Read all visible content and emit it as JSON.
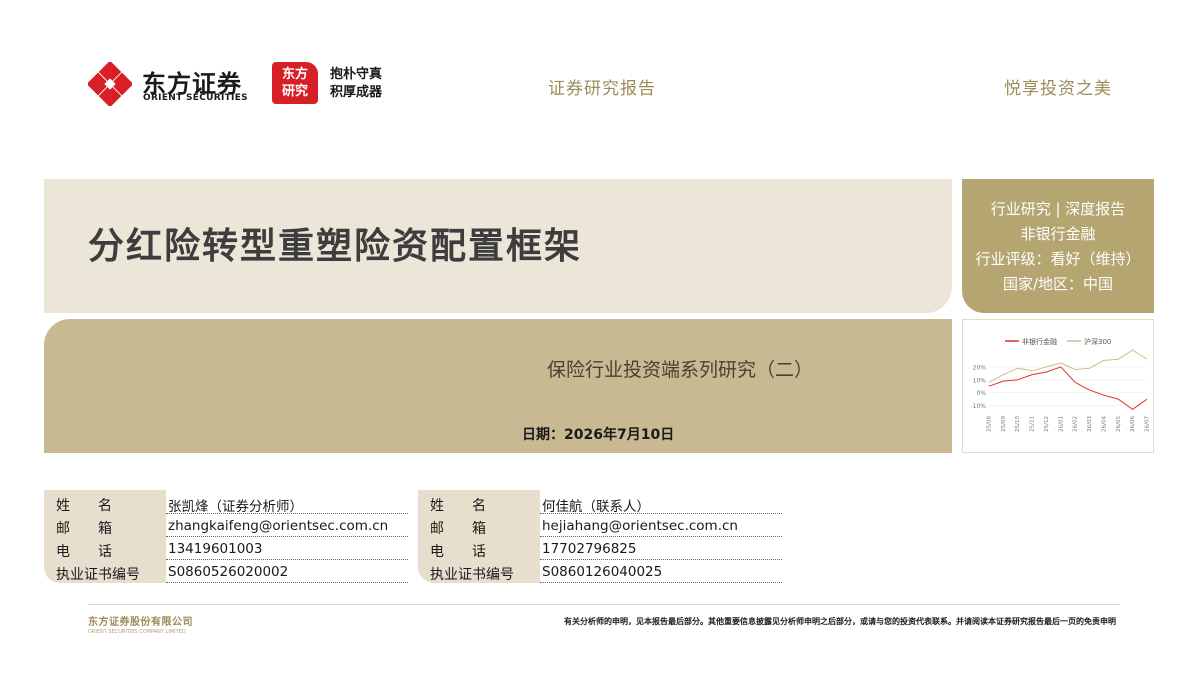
{
  "header": {
    "logo_cn": "东方证券",
    "logo_en": "ORIENT SECURITIES",
    "badge_line1": "东方",
    "badge_line2": "研究",
    "motto_line1": "抱朴守真",
    "motto_line2": "积厚成器",
    "center_title": "证券研究报告",
    "right_slogan": "悦享投资之美"
  },
  "report": {
    "title": "分红险转型重塑险资配置框架",
    "subtitle": "保险行业投资端系列研究（二）",
    "date": "日期：2026年7月10日"
  },
  "info": {
    "line1": "行业研究 | 深度报告",
    "line2": "非银行金融",
    "line3": "行业评级：看好（维持）",
    "line4": "国家/地区：中国"
  },
  "chart_data": {
    "type": "line",
    "x": [
      "25/08",
      "25/09",
      "25/10",
      "25/11",
      "25/12",
      "26/01",
      "26/02",
      "26/03",
      "26/04",
      "26/05",
      "26/06",
      "26/07"
    ],
    "series": [
      {
        "name": "非银行金融",
        "values": [
          5,
          9,
          10,
          14,
          16,
          20,
          8,
          2,
          -2,
          -5,
          -13,
          -5
        ],
        "color": "#e0302a"
      },
      {
        "name": "沪深300",
        "values": [
          8,
          14,
          19,
          17,
          20,
          23,
          18,
          19,
          25,
          26,
          33,
          26
        ],
        "color": "#cbbd8a"
      }
    ],
    "yticks": [
      "20%",
      "10%",
      "0%",
      "-10%"
    ],
    "ylim": [
      -15,
      30
    ]
  },
  "contacts": [
    {
      "rows": [
        {
          "label": "姓　　名",
          "value": "张凯烽（证券分析师）"
        },
        {
          "label": "邮　　箱",
          "value": "zhangkaifeng@orientsec.com.cn"
        },
        {
          "label": "电　　话",
          "value": "13419601003"
        },
        {
          "label": "执业证书编号",
          "value": "S0860526020002"
        }
      ]
    },
    {
      "rows": [
        {
          "label": "姓　　名",
          "value": "何佳航（联系人）"
        },
        {
          "label": "邮　　箱",
          "value": "hejiahang@orientsec.com.cn"
        },
        {
          "label": "电　　话",
          "value": "17702796825"
        },
        {
          "label": "执业证书编号",
          "value": "S0860126040025"
        }
      ]
    }
  ],
  "footer": {
    "company_cn": "东方证券股份有限公司",
    "company_en": "ORIENT SECURITIES COMPANY LIMITED",
    "disclaimer": "有关分析师的申明，见本报告最后部分。其他重要信息披露见分析师申明之后部分，或请与您的投资代表联系。并请阅读本证券研究报告最后一页的免责申明"
  },
  "colors": {
    "brand_red": "#d71f27",
    "gold": "#b5a571",
    "light_beige": "#ece6d8",
    "mid_beige": "#c8b992"
  }
}
